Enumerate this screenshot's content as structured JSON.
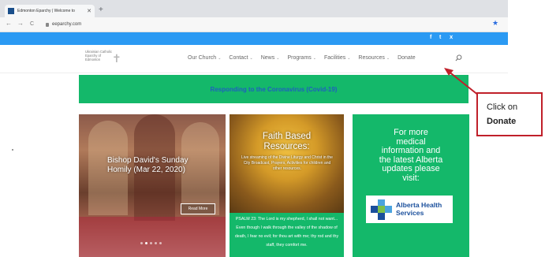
{
  "browser": {
    "tab_title": "Edmonton Eparchy | Welcome to",
    "tab_close": "✕",
    "new_tab": "+",
    "back": "←",
    "forward": "→",
    "reload": "C",
    "url": "eeparchy.com",
    "bookmark_star": "★"
  },
  "social": {
    "facebook": "f",
    "twitter": "t",
    "rss": "ⅹ"
  },
  "logo": {
    "line1": "Ukrainian Catholic",
    "line2": "Eparchy of",
    "line3": "Edmonton"
  },
  "menu": [
    {
      "label": "Our Church",
      "chevron": "⌄"
    },
    {
      "label": "Contact",
      "chevron": "⌄"
    },
    {
      "label": "News",
      "chevron": "⌄"
    },
    {
      "label": "Programs",
      "chevron": "⌄"
    },
    {
      "label": "Facilities",
      "chevron": "⌄"
    },
    {
      "label": "Resources",
      "chevron": "⌄"
    },
    {
      "label": "Donate",
      "chevron": ""
    }
  ],
  "banner": {
    "text": "Responding to the Coronavirus (Covid-19)"
  },
  "slider": {
    "title": "Bishop David's Sunday Homily (Mar 22, 2020)",
    "button": "Read More",
    "slide_count": 5,
    "active_slide": 1
  },
  "faith": {
    "title_line1": "Faith Based",
    "title_line2": "Resources:",
    "description": "Live streaming of the Divine Liturgy and Christ in the City Broadcast, Prayers, Activities for children and other resources.",
    "psalm": "PSALM 23: The Lord is my shepherd, I shall not want... Even though I walk through the valley of the shadow of death, I fear no evil; for thou art with me; thy rod and thy staff, they comfort me."
  },
  "info": {
    "line1": "For more",
    "line2": "medical",
    "line3": "information and",
    "line4": "the latest Alberta",
    "line5": "updates please",
    "line6": "visit:",
    "ahs_line1": "Alberta Health",
    "ahs_line2": "Services"
  },
  "annotation": {
    "line1": "Click on",
    "line2": "Donate"
  },
  "colors": {
    "accent_blue": "#2b9af3",
    "green": "#14b86a",
    "banner_text": "#1f5fbf",
    "callout_border": "#c0202a"
  }
}
